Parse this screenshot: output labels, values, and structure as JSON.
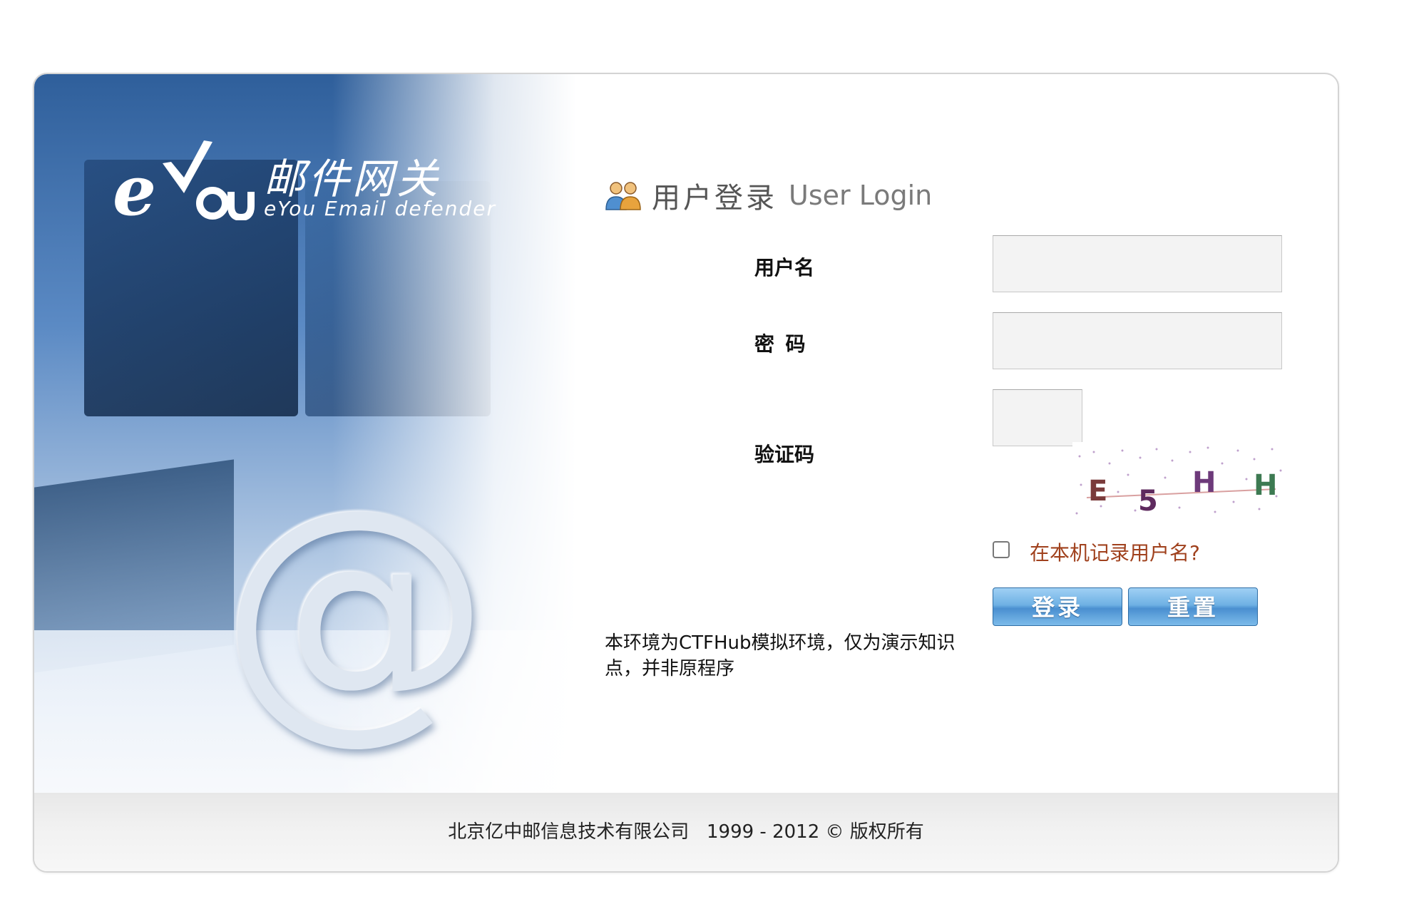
{
  "logo": {
    "brand_mark": "eYou",
    "product_name_cn": "邮件网关",
    "product_name_en": "eYou Email defender"
  },
  "hero": {
    "symbol": "@"
  },
  "login": {
    "title_cn": "用户登录",
    "title_en": "User Login",
    "icon": "users-icon",
    "username_label": "用户名",
    "username_value": "",
    "password_label": "密  码",
    "password_value": "",
    "captcha_label": "验证码",
    "captcha_value": "",
    "captcha_chars": [
      "E",
      "5",
      "H",
      "H"
    ],
    "remember_checked": false,
    "remember_label": "在本机记录用户名?",
    "login_button": "登录",
    "reset_button": "重置"
  },
  "notice": "本环境为CTFHub模拟环境，仅为演示知识点，并非原程序",
  "footer": {
    "copyright": "北京亿中邮信息技术有限公司   1999 - 2012 © 版权所有"
  },
  "colors": {
    "button_blue": "#6fb1e4",
    "remember_text": "#a0411d",
    "field_bg": "#f3f3f3"
  }
}
